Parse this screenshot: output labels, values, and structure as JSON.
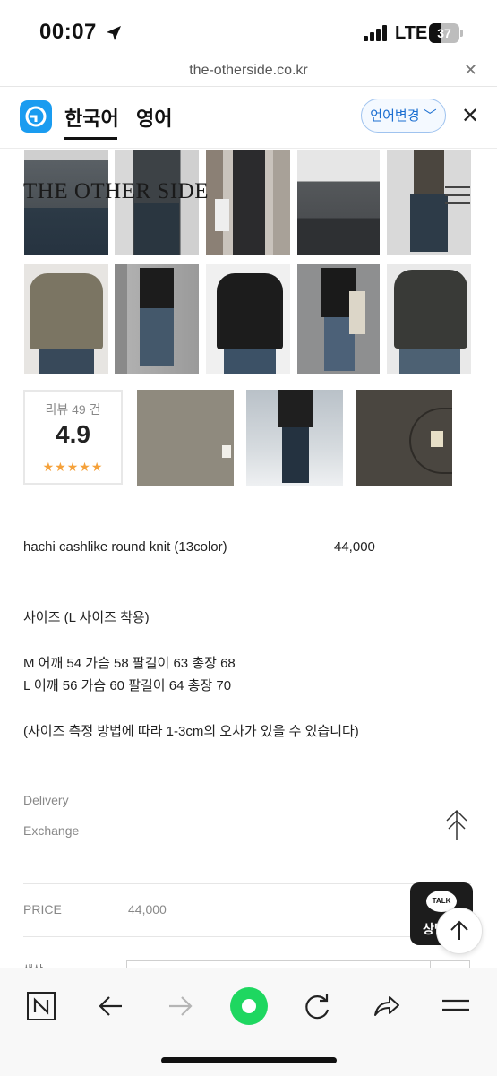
{
  "status_bar": {
    "time": "00:07",
    "network": "LTE",
    "battery": "37"
  },
  "browser": {
    "url": "the-otherside.co.kr"
  },
  "translate_bar": {
    "source_lang": "한국어",
    "target_lang": "영어",
    "change_label": "언어변경"
  },
  "site": {
    "brand": "THE OTHER SIDE"
  },
  "reviews": {
    "count_label": "리뷰 49 건",
    "score": "4.9",
    "stars": "★★★★★"
  },
  "product": {
    "name": "hachi cashlike round knit (13color)",
    "price": "44,000",
    "size_note": "사이즈 (L 사이즈 착용)",
    "size_m": "M 어깨 54 가슴 58 팔길이 63 총장 68",
    "size_l": "L 어깨 56 가슴 60 팔길이 64 총장 70",
    "measure_note": "(사이즈 측정 방법에 따라 1-3cm의 오차가 있을 수 있습니다)"
  },
  "info_links": {
    "delivery": "Delivery",
    "exchange": "Exchange"
  },
  "price_row": {
    "label": "PRICE",
    "value": "44,000"
  },
  "option_label": "색상",
  "kakao": {
    "bubble": "TALK",
    "label": "상담"
  },
  "colors": {
    "accent": "#1a9cf0",
    "star": "#f5a13a",
    "safari_green": "#1ed760"
  }
}
